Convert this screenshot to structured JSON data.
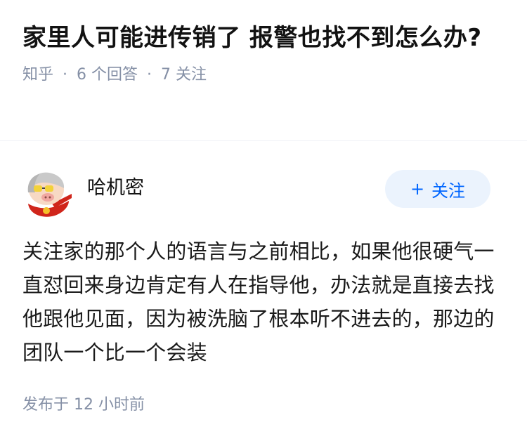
{
  "question": {
    "title": "家里人可能进传销了 报警也找不到怎么办?",
    "source": "知乎",
    "answer_count": "6 个回答",
    "follower_count": "7 关注"
  },
  "answer": {
    "author_name": "哈机密",
    "follow_label": "关注",
    "content": "关注家的那个人的语言与之前相比，如果他很硬气一直怼回来身边肯定有人在指导他，办法就是直接去找他跟他见面，因为被洗脑了根本听不进去的，那边的团队一个比一个会装",
    "published_time": "发布于 12 小时前"
  },
  "colors": {
    "accent": "#0066ff",
    "follow_bg": "#ebf3fd",
    "meta_text": "#8590a6"
  },
  "icons": {
    "follow": "plus-icon",
    "avatar": "avatar"
  }
}
